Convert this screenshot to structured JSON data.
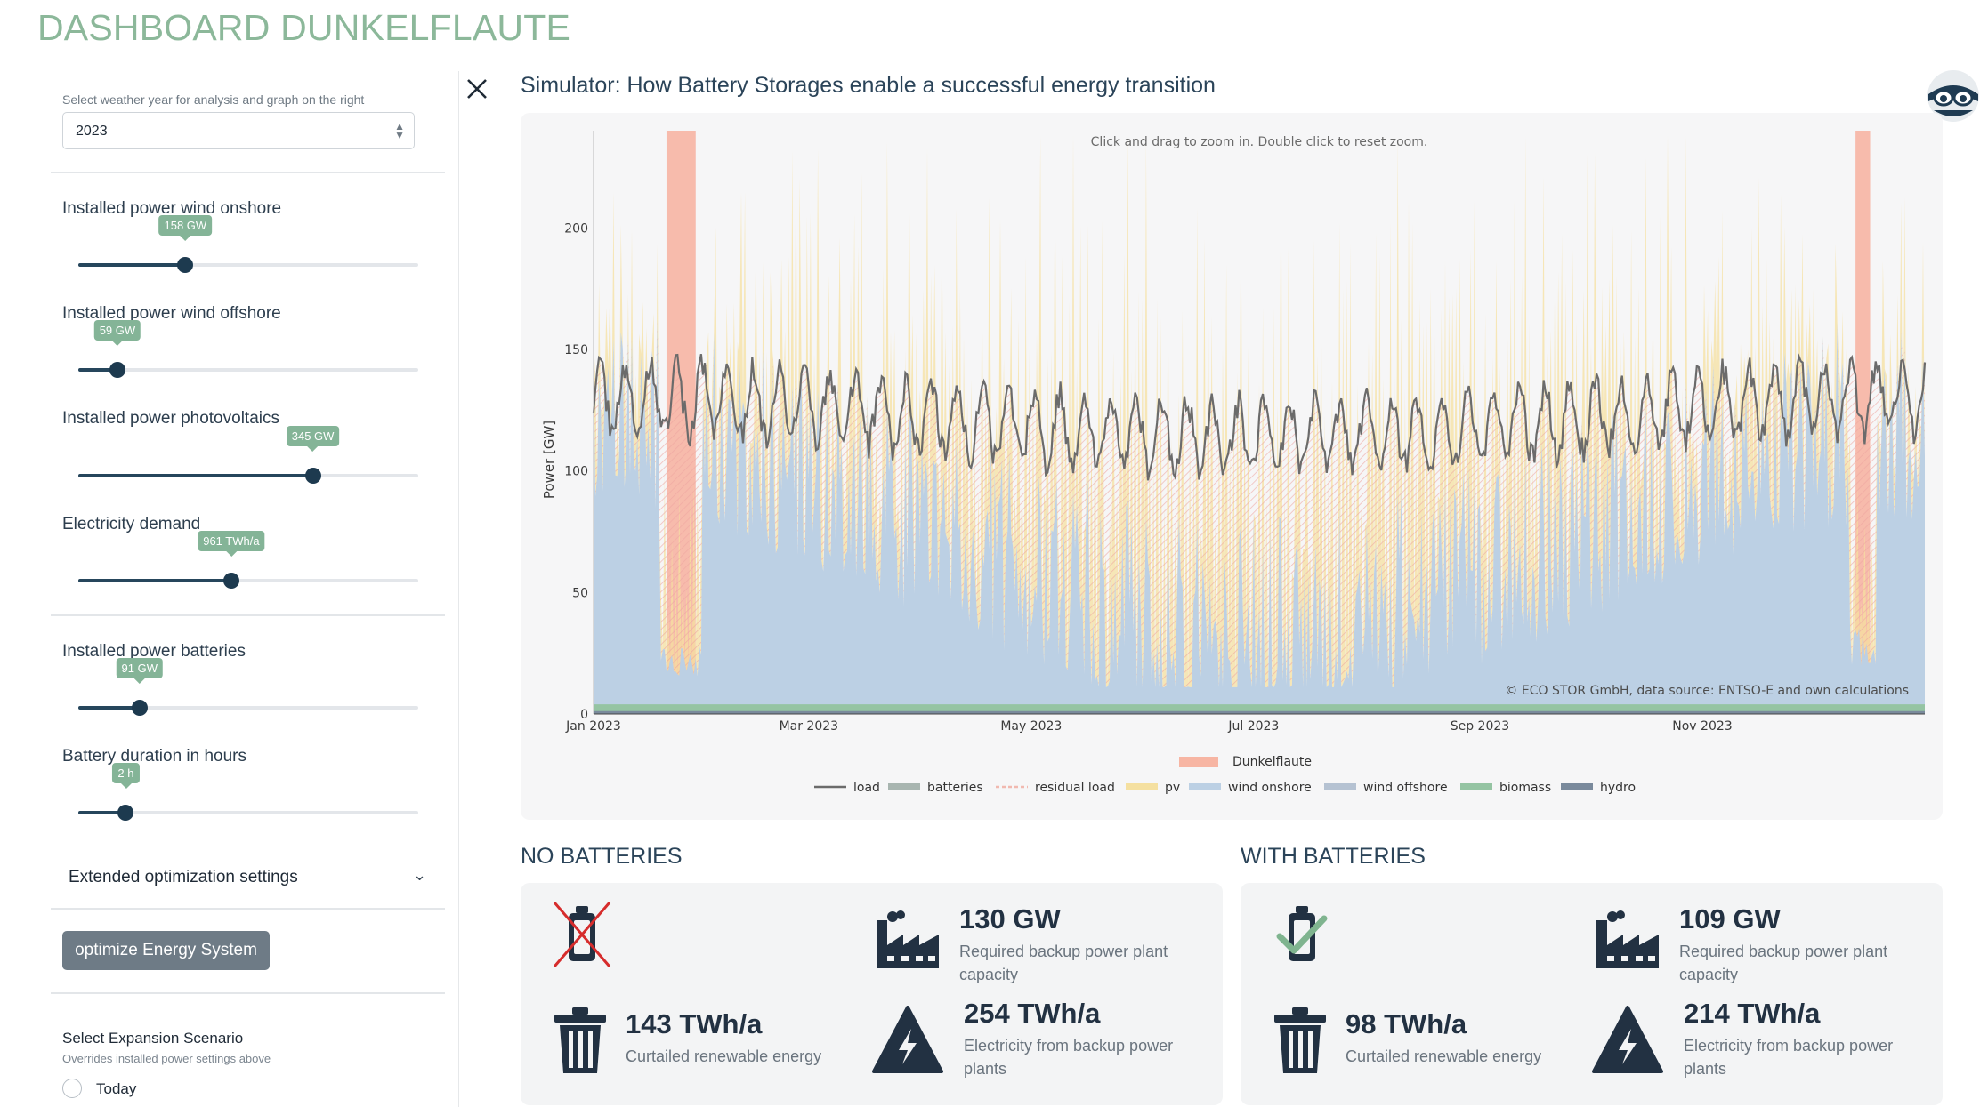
{
  "app": {
    "title": "DASHBOARD DUNKELFLAUTE"
  },
  "sidebar": {
    "weather_year_label": "Select weather year for analysis and graph on the right",
    "weather_year_value": "2023",
    "sliders": [
      {
        "label": "Installed power wind onshore",
        "value": "158 GW",
        "fraction": 0.315
      },
      {
        "label": "Installed power wind offshore",
        "value": "59 GW",
        "fraction": 0.115
      },
      {
        "label": "Installed power photovoltaics",
        "value": "345 GW",
        "fraction": 0.69
      },
      {
        "label": "Electricity demand",
        "value": "961 TWh/a",
        "fraction": 0.45
      },
      {
        "label": "Installed power batteries",
        "value": "91 GW",
        "fraction": 0.18
      },
      {
        "label": "Battery duration in hours",
        "value": "2 h",
        "fraction": 0.14
      }
    ],
    "extended_settings_label": "Extended optimization settings",
    "optimize_button": "optimize Energy System",
    "scenario_title": "Select Expansion Scenario",
    "scenario_subtitle": "Overrides installed power settings above",
    "scenario_options": [
      "Today"
    ]
  },
  "main": {
    "title": "Simulator: How Battery Storages enable a successful energy transition",
    "no_batteries": {
      "heading": "NO BATTERIES",
      "backup_capacity_value": "130 GW",
      "backup_capacity_desc": "Required backup power plant capacity",
      "curtailed_value": "143 TWh/a",
      "curtailed_desc": "Curtailed renewable energy",
      "backup_energy_value": "254 TWh/a",
      "backup_energy_desc": "Electricity from backup power plants"
    },
    "with_batteries": {
      "heading": "WITH BATTERIES",
      "backup_capacity_value": "109 GW",
      "backup_capacity_desc": "Required backup power plant capacity",
      "curtailed_value": "98 TWh/a",
      "curtailed_desc": "Curtailed renewable energy",
      "backup_energy_value": "214 TWh/a",
      "backup_energy_desc": "Electricity from backup power plants"
    }
  },
  "colors": {
    "accent_green": "#84b497",
    "navy": "#1d3a4f",
    "load": "#6b6b6b",
    "wind_onshore": "#bcd0e4",
    "pv": "#f5e0a0",
    "residual_load": "#f1b9b0",
    "dunkelflaute": "#f7b5a3",
    "biomass": "#95c4a3",
    "hydro": "#7a8a9c"
  },
  "chart_data": {
    "type": "area",
    "title": "",
    "hint": "Click and drag to zoom in. Double click to reset zoom.",
    "ylabel": "Power [GW]",
    "xlabel": "",
    "ylim": [
      0,
      240
    ],
    "x_tick_labels": [
      "Jan 2023",
      "Mar 2023",
      "May 2023",
      "Jul 2023",
      "Sep 2023",
      "Nov 2023"
    ],
    "y_tick_labels": [
      "0",
      "50",
      "100",
      "150",
      "200"
    ],
    "credit": "© ECO STOR GmbH, data source: ENTSO-E and own calculations",
    "legend_top": "Dunkelflaute",
    "legend": [
      "load",
      "batteries",
      "residual load",
      "pv",
      "wind onshore",
      "wind offshore",
      "biomass",
      "hydro"
    ],
    "dunkelflaute_periods_day_of_year": [
      [
        20,
        28
      ],
      [
        346,
        350
      ]
    ],
    "series": [
      {
        "name": "load",
        "approx_range": [
          90,
          150
        ]
      },
      {
        "name": "wind onshore",
        "approx_range": [
          5,
          170
        ]
      },
      {
        "name": "pv",
        "approx_range": [
          0,
          230
        ]
      },
      {
        "name": "biomass",
        "approx_range": [
          3,
          5
        ]
      },
      {
        "name": "hydro",
        "approx_range": [
          1,
          2
        ]
      }
    ]
  }
}
